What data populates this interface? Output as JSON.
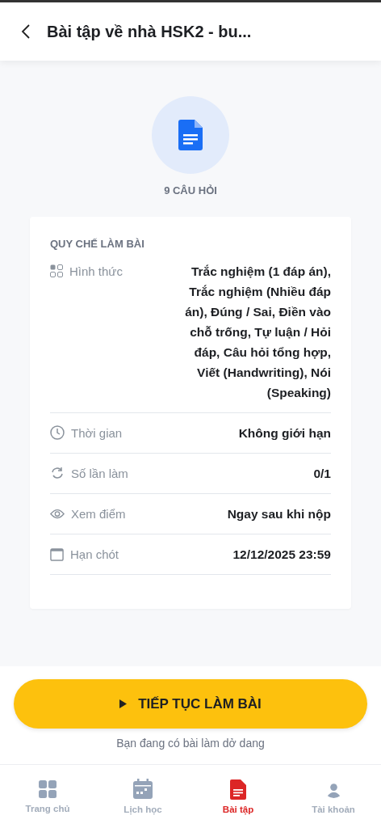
{
  "header": {
    "title": "Bài tập về nhà HSK2 - bu..."
  },
  "summary": {
    "question_count": "9 CÂU HỎI"
  },
  "rules": {
    "title": "QUY CHẾ LÀM BÀI",
    "items": [
      {
        "kind": "format",
        "label": "Hình thức",
        "value": "Trắc nghiệm (1 đáp án), Trắc nghiệm (Nhiều đáp án), Đúng / Sai, Điền vào chỗ trống, Tự luận / Hỏi đáp, Câu hỏi tổng hợp, Viết (Handwriting), Nói (Speaking)"
      },
      {
        "kind": "time",
        "label": "Thời gian",
        "value": "Không giới hạn"
      },
      {
        "kind": "attempts",
        "label": "Số lần làm",
        "value": "0/1"
      },
      {
        "kind": "score",
        "label": "Xem điểm",
        "value": "Ngay sau khi nộp"
      },
      {
        "kind": "deadline",
        "label": "Hạn chót",
        "value": "12/12/2025 23:59"
      }
    ]
  },
  "action": {
    "button": "TIẾP TỤC LÀM BÀI",
    "note": "Bạn đang có bài làm dở dang"
  },
  "tabs": [
    {
      "kind": "home",
      "label": "Trang chủ",
      "selected": false
    },
    {
      "kind": "schedule",
      "label": "Lịch học",
      "selected": false
    },
    {
      "kind": "homework",
      "label": "Bài tập",
      "selected": true
    },
    {
      "kind": "account",
      "label": "Tài khoản",
      "selected": false
    }
  ]
}
